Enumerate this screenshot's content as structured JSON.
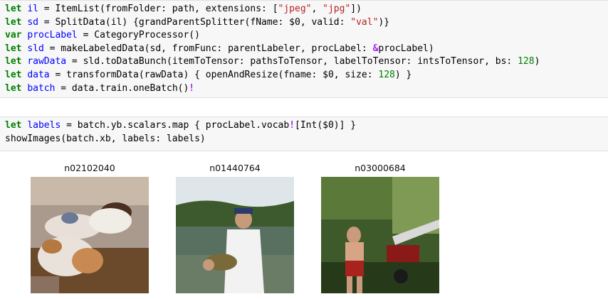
{
  "cells": [
    {
      "lines": [
        [
          [
            "kw",
            "let"
          ],
          [
            "p",
            " "
          ],
          [
            "var",
            "il"
          ],
          [
            "p",
            " = ItemList(fromFolder: path, extensions: ["
          ],
          [
            "str",
            "\"jpeg\""
          ],
          [
            "p",
            ", "
          ],
          [
            "str",
            "\"jpg\""
          ],
          [
            "p",
            "])"
          ]
        ],
        [
          [
            "kw",
            "let"
          ],
          [
            "p",
            " "
          ],
          [
            "var",
            "sd"
          ],
          [
            "p",
            " = SplitData(il) {grandParentSplitter(fName: $0, valid: "
          ],
          [
            "str",
            "\"val\""
          ],
          [
            "p",
            ")}"
          ]
        ],
        [
          [
            "kw",
            "var"
          ],
          [
            "p",
            " "
          ],
          [
            "var",
            "procLabel"
          ],
          [
            "p",
            " = CategoryProcessor()"
          ]
        ],
        [
          [
            "kw",
            "let"
          ],
          [
            "p",
            " "
          ],
          [
            "var",
            "sld"
          ],
          [
            "p",
            " = makeLabeledData(sd, fromFunc: parentLabeler, procLabel: "
          ],
          [
            "op",
            "&"
          ],
          [
            "p",
            "procLabel)"
          ]
        ],
        [
          [
            "kw",
            "let"
          ],
          [
            "p",
            " "
          ],
          [
            "var",
            "rawData"
          ],
          [
            "p",
            " = sld.toDataBunch(itemToTensor: pathsToTensor, labelToTensor: intsToTensor, bs: "
          ],
          [
            "num",
            "128"
          ],
          [
            "p",
            ")"
          ]
        ],
        [
          [
            "kw",
            "let"
          ],
          [
            "p",
            " "
          ],
          [
            "var",
            "data"
          ],
          [
            "p",
            " = transformData(rawData) { openAndResize(fname: $0, size: "
          ],
          [
            "num",
            "128"
          ],
          [
            "p",
            ") }"
          ]
        ],
        [
          [
            "kw",
            "let"
          ],
          [
            "p",
            " "
          ],
          [
            "var",
            "batch"
          ],
          [
            "p",
            " = data.train.oneBatch()"
          ],
          [
            "op",
            "!"
          ]
        ]
      ]
    },
    {
      "lines": [
        [
          [
            "kw",
            "let"
          ],
          [
            "p",
            " "
          ],
          [
            "var",
            "labels"
          ],
          [
            "p",
            " = batch.yb.scalars.map { procLabel.vocab"
          ],
          [
            "op",
            "!"
          ],
          [
            "p",
            "[Int($0)] }"
          ]
        ],
        [
          [
            "p",
            "showImages(batch.xb, labels: labels)"
          ]
        ]
      ]
    }
  ],
  "output": {
    "images": [
      {
        "label": "n02102040",
        "description": "photo-dogs-on-couch"
      },
      {
        "label": "n01440764",
        "description": "photo-man-holding-fish"
      },
      {
        "label": "n03000684",
        "description": "photo-man-with-chainsaw"
      }
    ]
  }
}
